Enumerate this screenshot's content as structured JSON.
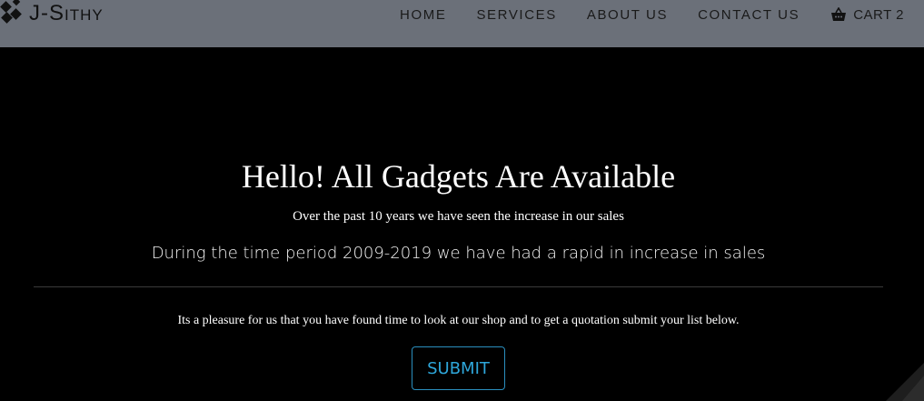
{
  "header": {
    "brand": "J-Sithy",
    "nav": [
      {
        "label": "HOME"
      },
      {
        "label": "SERVICES"
      },
      {
        "label": "ABOUT US"
      },
      {
        "label": "CONTACT US"
      }
    ],
    "cart": {
      "label": "CART 2",
      "icon": "basket-icon"
    }
  },
  "hero": {
    "title": "Hello! All Gadgets Are Available",
    "subtitle": "Over the past 10 years we have seen the increase in our sales",
    "lead": "During the time period 2009-2019 we have had a rapid in increase in sales",
    "note": "Its a pleasure for us that you have found time to look at our shop and to get a quotation submit your list below.",
    "submit_label": "SUBMIT"
  },
  "colors": {
    "navbar_bg": "#6b7079",
    "hero_bg": "#000000",
    "accent": "#2ea7db"
  }
}
